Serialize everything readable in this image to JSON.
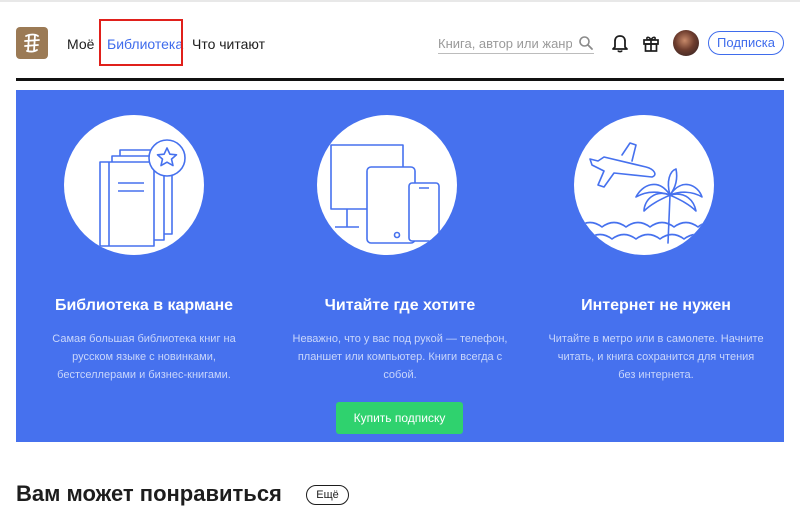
{
  "header": {
    "nav": [
      {
        "label": "Моё"
      },
      {
        "label": "Библиотека"
      },
      {
        "label": "Что читают"
      }
    ],
    "search": {
      "placeholder": "Книга, автор или жанр",
      "value": ""
    },
    "icons": [
      "bookmate-logo-icon",
      "search-icon",
      "bell-icon",
      "gift-icon"
    ],
    "subscribe_label": "Подписка"
  },
  "hero": {
    "features": [
      {
        "icon": "book-star-icon",
        "title": "Библиотека в кармане",
        "description": "Самая большая библиотека книг на русском языке с новинками, бестселлерами и бизнес-книгами."
      },
      {
        "icon": "devices-icon",
        "title": "Читайте где хотите",
        "description": "Неважно, что у вас под рукой — телефон, планшет или компьютер. Книги всегда с собой."
      },
      {
        "icon": "plane-palm-icon",
        "title": "Интернет не нужен",
        "description": "Читайте в метро или в самолете. Начните читать, и книга сохранится для чтения без интернета."
      }
    ],
    "buy_label": "Купить подписку"
  },
  "recommendations": {
    "title": "Вам может понравиться",
    "more_label": "Ещё"
  },
  "colors": {
    "accent": "#3f6cec",
    "hero_background": "#4671ee",
    "buy_button": "#2fd26e",
    "highlight": "#e0201b"
  }
}
